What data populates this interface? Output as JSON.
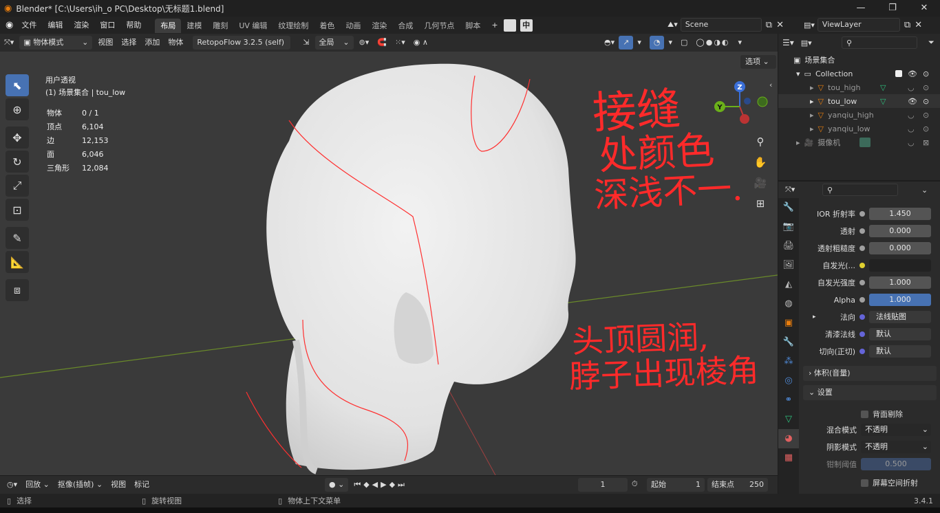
{
  "window": {
    "title": "Blender* [C:\\Users\\ih_o PC\\Desktop\\无标题1.blend]"
  },
  "menu": {
    "items": [
      "文件",
      "编辑",
      "渲染",
      "窗口",
      "帮助"
    ]
  },
  "workspaces": [
    "布局",
    "建模",
    "雕刻",
    "UV 编辑",
    "纹理绘制",
    "着色",
    "动画",
    "渲染",
    "合成",
    "几何节点",
    "脚本"
  ],
  "active_workspace": "布局",
  "ime_label": "中",
  "scene": {
    "name": "Scene",
    "view_layer": "ViewLayer"
  },
  "viewport_header": {
    "mode": "物体模式",
    "menus": [
      "视图",
      "选择",
      "添加",
      "物体"
    ],
    "addon": "RetopoFlow 3.2.5 (self)",
    "transform_orientation": "全局",
    "options_label": "选项"
  },
  "viewport_info": {
    "view": "用户透视",
    "collection": "(1) 场景集合 | tou_low"
  },
  "stats": [
    {
      "label": "物体",
      "value": "0 / 1"
    },
    {
      "label": "顶点",
      "value": "6,104"
    },
    {
      "label": "边",
      "value": "12,153"
    },
    {
      "label": "面",
      "value": "6,046"
    },
    {
      "label": "三角形",
      "value": "12,084"
    }
  ],
  "annotations": {
    "note1_lines": [
      "接缝",
      "处颜色",
      "深浅不一."
    ],
    "note2_lines": [
      "头顶圆润,",
      "脖子出现棱角"
    ]
  },
  "gizmo": {
    "z": "Z",
    "y": "Y"
  },
  "outliner": {
    "root": "场景集合",
    "collection": "Collection",
    "objects": [
      "tou_high",
      "tou_low",
      "yanqiu_high",
      "yanqiu_low"
    ],
    "camera": "摄像机"
  },
  "properties": {
    "ior": {
      "label": "IOR 折射率",
      "value": "1.450"
    },
    "transmission": {
      "label": "透射",
      "value": "0.000"
    },
    "transmission_roughness": {
      "label": "透射粗糙度",
      "value": "0.000"
    },
    "emission": {
      "label": "自发光(..."
    },
    "emission_strength": {
      "label": "自发光强度",
      "value": "1.000"
    },
    "alpha": {
      "label": "Alpha",
      "value": "1.000"
    },
    "normal": {
      "label": "法向",
      "value": "法线贴图"
    },
    "clearcoat_normal": {
      "label": "清漆法线",
      "value": "默认"
    },
    "tangent": {
      "label": "切向(正切)",
      "value": "默认"
    },
    "volume_section": "体积(音量)",
    "settings_section": "设置",
    "backface_culling": "背面剔除",
    "blend_mode": {
      "label": "混合模式",
      "value": "不透明"
    },
    "shadow_mode": {
      "label": "阴影模式",
      "value": "不透明"
    },
    "clip_threshold": {
      "label": "钳制阈值",
      "value": "0.500"
    },
    "screen_space_refraction": "屏幕空间折射"
  },
  "timeline": {
    "menus": [
      "回放",
      "抠像(插帧)",
      "视图",
      "标记"
    ],
    "current_frame": "1",
    "start_label": "起始",
    "start": "1",
    "end_label": "结束点",
    "end": "250"
  },
  "statusbar": {
    "select": "选择",
    "rotate": "旋转视图",
    "context": "物体上下文菜单",
    "version": "3.4.1"
  },
  "colors": {
    "accent": "#4772b3",
    "header": "#2b2b2b",
    "viewport": "#3a3a3a",
    "annotation": "#ff2222",
    "orange": "#e87d0d"
  }
}
